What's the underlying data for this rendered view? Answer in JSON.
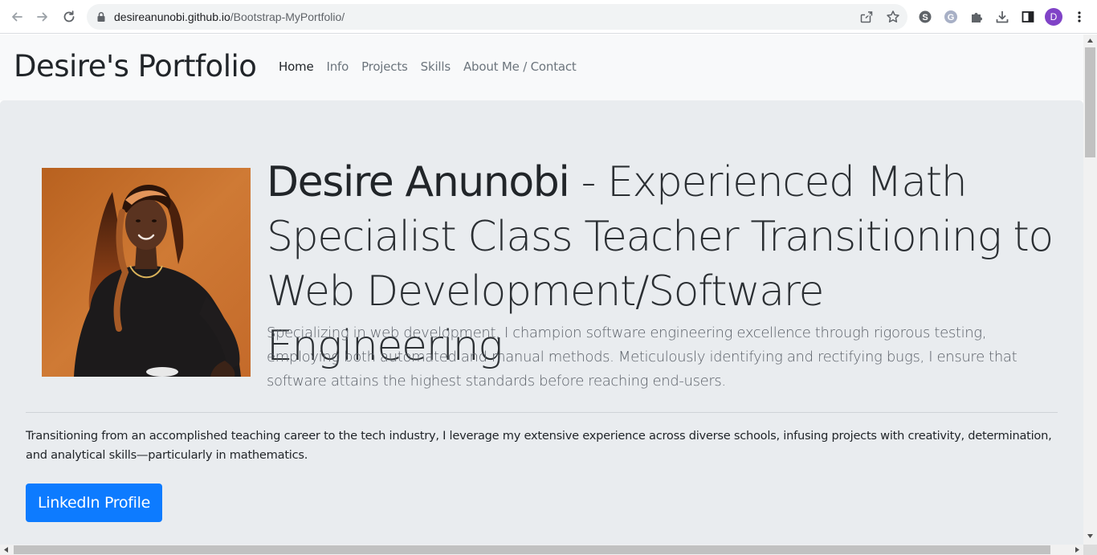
{
  "browser": {
    "url_host": "desireanunobi.github.io",
    "url_path": "/Bootstrap-MyPortfolio/",
    "profile_initial": "D",
    "icons": [
      "back-icon",
      "forward-icon",
      "reload-icon",
      "lock-icon",
      "share-icon",
      "bookmark-star-icon",
      "skype-extension-icon",
      "grammarly-extension-icon",
      "extensions-puzzle-icon",
      "download-icon",
      "side-panel-icon",
      "menu-kebab-icon"
    ]
  },
  "navbar": {
    "brand": "Desire's Portfolio",
    "links": [
      {
        "label": "Home",
        "active": true
      },
      {
        "label": "Info",
        "active": false
      },
      {
        "label": "Projects",
        "active": false
      },
      {
        "label": "Skills",
        "active": false
      },
      {
        "label": "About Me / Contact",
        "active": false
      }
    ]
  },
  "hero": {
    "name": "Desire Anunobi",
    "role": " - Experienced Math Specialist Class Teacher Transitioning to Web Development/Software Engineering",
    "lead": "Specializing in web development, I champion software engineering excellence through rigorous testing, employing both automated and manual methods. Meticulously identifying and rectifying bugs, I ensure that software attains the highest standards before reaching end-users.",
    "bio": "Transitioning from an accomplished teaching career to the tech industry, I leverage my extensive experience across diverse schools, infusing projects with creativity, determination, and analytical skills—particularly in mathematics.",
    "button_label": "LinkedIn Profile"
  },
  "colors": {
    "navbar_bg": "#f8f9fa",
    "jumbotron_bg": "#e9ecef",
    "primary_button": "#0d7bff",
    "profile_avatar": "#8043c7"
  }
}
